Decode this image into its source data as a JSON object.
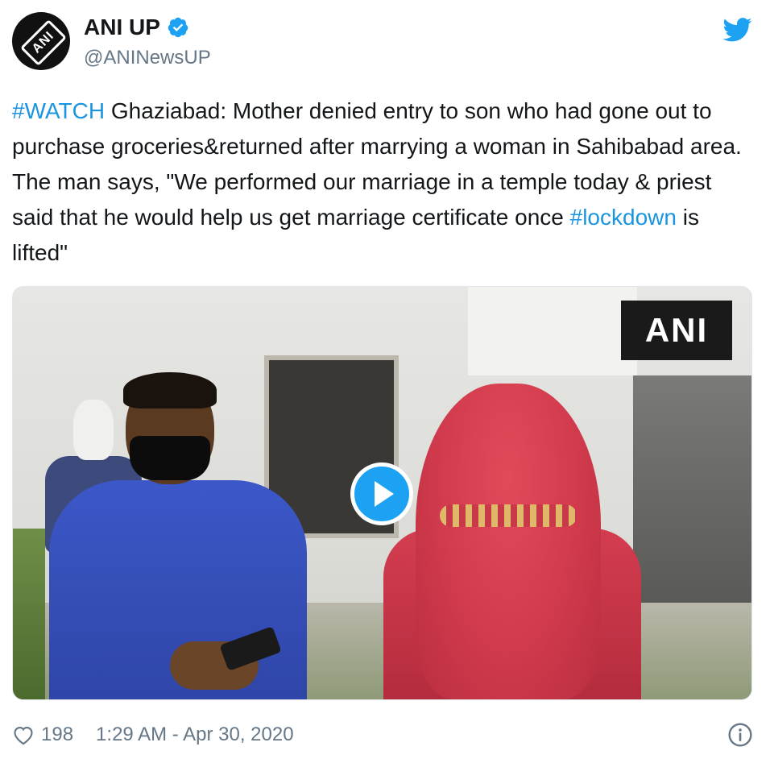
{
  "author": {
    "display_name": "ANI UP",
    "handle": "@ANINewsUP",
    "avatar_text": "ANI"
  },
  "tweet": {
    "segments": [
      {
        "text": "#WATCH",
        "type": "hashtag"
      },
      {
        "text": " Ghaziabad: Mother denied entry to son who had gone out to purchase groceries&returned after marrying a woman in Sahibabad area. The man says, \"We performed our marriage in a temple today & priest said that he would help us get marriage certificate once ",
        "type": "text"
      },
      {
        "text": "#lockdown",
        "type": "hashtag"
      },
      {
        "text": " is lifted\"",
        "type": "text"
      }
    ]
  },
  "media": {
    "watermark": "ANI"
  },
  "footer": {
    "likes": "198",
    "timestamp": "1:29 AM - Apr 30, 2020"
  },
  "colors": {
    "brand": "#1da1f2",
    "link": "#1b95e0",
    "muted": "#657786"
  },
  "icons": [
    "verified-icon",
    "twitter-bird-icon",
    "play-icon",
    "heart-icon",
    "info-icon"
  ]
}
